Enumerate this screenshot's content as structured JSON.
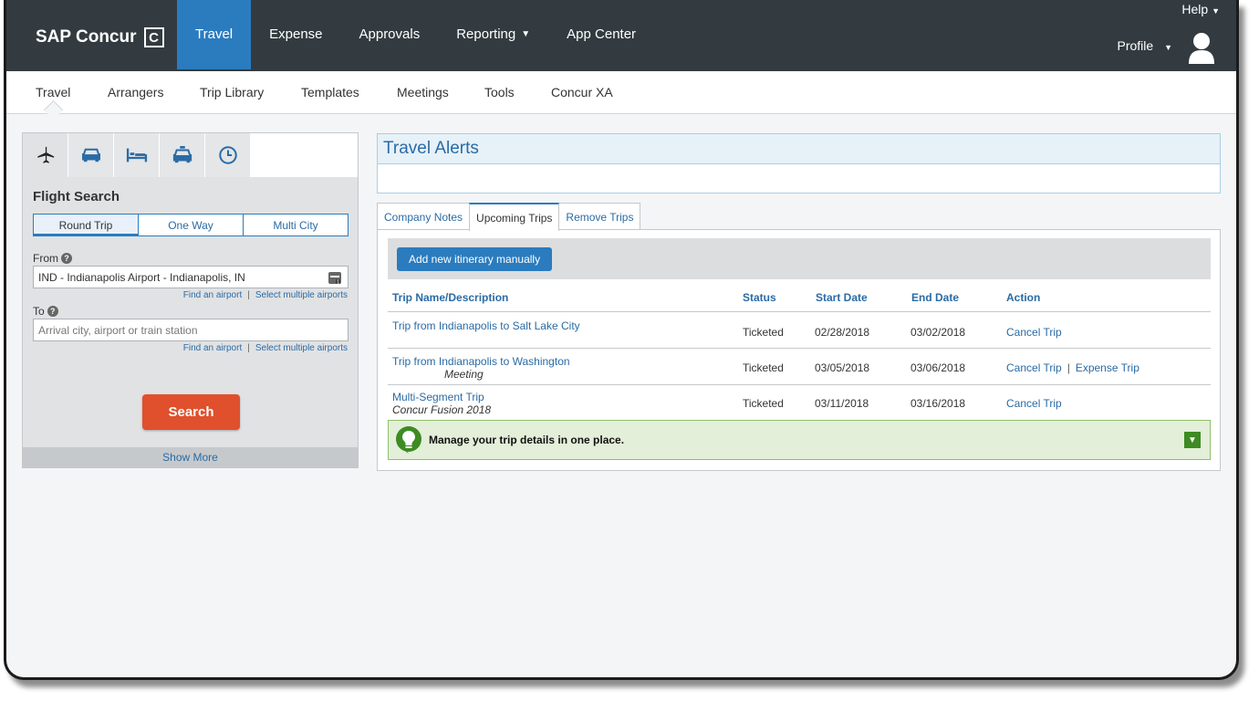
{
  "app": {
    "brand": "SAP Concur",
    "brand_mark": "C"
  },
  "topnav": {
    "items": [
      {
        "label": "Travel",
        "active": true
      },
      {
        "label": "Expense"
      },
      {
        "label": "Approvals"
      },
      {
        "label": "Reporting",
        "dropdown": true
      },
      {
        "label": "App Center"
      }
    ],
    "help": "Help",
    "profile": "Profile"
  },
  "subnav": {
    "items": [
      "Travel",
      "Arrangers",
      "Trip Library",
      "Templates",
      "Meetings",
      "Tools",
      "Concur XA"
    ],
    "active": "Travel"
  },
  "search_panel": {
    "mode_icons": [
      "plane-icon",
      "car-icon",
      "hotel-bed-icon",
      "taxi-icon",
      "clock-icon"
    ],
    "title": "Flight Search",
    "trip_types": [
      "Round Trip",
      "One Way",
      "Multi City"
    ],
    "selected_trip_type": "Round Trip",
    "from_label": "From",
    "from_value": "IND - Indianapolis Airport - Indianapolis, IN",
    "to_label": "To",
    "to_placeholder": "Arrival city, airport or train station",
    "find_airport": "Find an airport",
    "select_multiple": "Select multiple airports",
    "search_button": "Search",
    "show_more": "Show More"
  },
  "alerts": {
    "title": "Travel Alerts"
  },
  "trips": {
    "tabs": [
      "Company Notes",
      "Upcoming Trips",
      "Remove Trips"
    ],
    "active_tab": "Upcoming Trips",
    "add_button": "Add new itinerary manually",
    "headers": [
      "Trip Name/Description",
      "Status",
      "Start Date",
      "End Date",
      "Action"
    ],
    "rows": [
      {
        "name": "Trip from Indianapolis to Salt Lake City",
        "sub": "",
        "status": "Ticketed",
        "start": "02/28/2018",
        "end": "03/02/2018",
        "actions": [
          "Cancel Trip"
        ]
      },
      {
        "name": "Trip from Indianapolis to Washington",
        "sub": "Meeting",
        "status": "Ticketed",
        "start": "03/05/2018",
        "end": "03/06/2018",
        "actions": [
          "Cancel Trip",
          "Expense Trip"
        ]
      },
      {
        "name": "Multi-Segment Trip",
        "sub": "Concur Fusion 2018",
        "status": "Ticketed",
        "start": "03/11/2018",
        "end": "03/16/2018",
        "actions": [
          "Cancel Trip"
        ]
      }
    ],
    "tip": "Manage your trip details in one place."
  },
  "colors": {
    "topbar": "#333b40",
    "accent": "#2a7cbf",
    "search": "#e0502c",
    "tip_bg": "#e3efd9"
  }
}
